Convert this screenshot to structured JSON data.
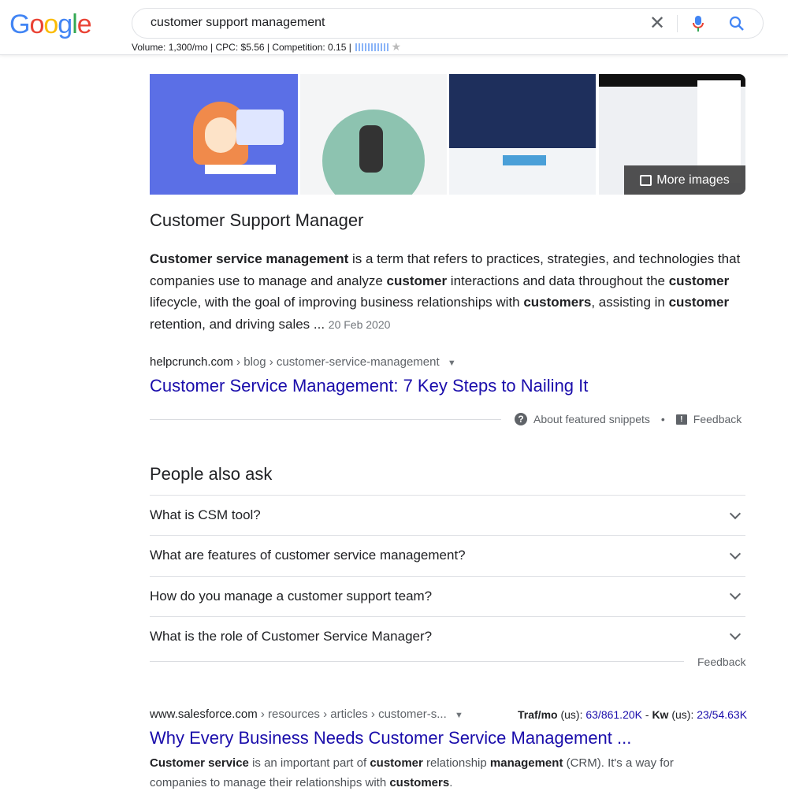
{
  "header": {
    "logo": "Google",
    "query": "customer support management",
    "seo_stats": "Volume: 1,300/mo | CPC: $5.56 | Competition: 0.15 |"
  },
  "images": {
    "more_label": "More images"
  },
  "featured": {
    "title": "Customer Support Manager",
    "snippet": [
      {
        "b": "Customer service management"
      },
      {
        "t": " is a term that refers to practices, strategies, and technologies that companies use to manage and analyze "
      },
      {
        "b": "customer"
      },
      {
        "t": " interactions and data throughout the "
      },
      {
        "b": "customer"
      },
      {
        "t": " lifecycle, with the goal of improving business relationships with "
      },
      {
        "b": "customers"
      },
      {
        "t": ", assisting in "
      },
      {
        "b": "customer"
      },
      {
        "t": " retention, and driving sales ... "
      }
    ],
    "date": "20 Feb 2020",
    "domain": "helpcrunch.com",
    "path": " › blog › customer-service-management",
    "link": "Customer Service Management: 7 Key Steps to Nailing It",
    "about": "About featured snippets",
    "feedback": "Feedback"
  },
  "paa": {
    "heading": "People also ask",
    "questions": [
      "What is CSM tool?",
      "What are features of customer service management?",
      "How do you manage a customer support team?",
      "What is the role of Customer Service Manager?"
    ],
    "feedback": "Feedback"
  },
  "result": {
    "domain": "www.salesforce.com",
    "path": " › resources › articles › customer-s...",
    "traf_label": "Traf/mo",
    "traf_region": " (us): ",
    "traf_value": "63/861.20K",
    "sep": " - ",
    "kw_label": "Kw",
    "kw_region": " (us): ",
    "kw_value": "23/54.63K",
    "title": "Why Every Business Needs Customer Service Management ...",
    "snippet": [
      {
        "b": "Customer service"
      },
      {
        "t": " is an important part of "
      },
      {
        "b": "customer"
      },
      {
        "t": " relationship "
      },
      {
        "b": "management"
      },
      {
        "t": " (CRM). It's a way for companies to manage their relationships with "
      },
      {
        "b": "customers"
      },
      {
        "t": "."
      }
    ]
  }
}
